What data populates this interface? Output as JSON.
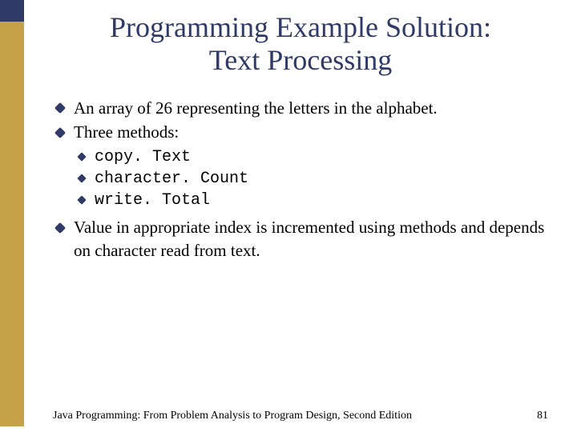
{
  "title_line1": "Programming Example Solution:",
  "title_line2": "Text Processing",
  "bullets": {
    "b0": "An array of 26 representing the letters in the alphabet.",
    "b1": "Three methods:",
    "b2": "Value in appropriate index is incremented using methods and depends on character read from text."
  },
  "methods": {
    "m0": "copy. Text",
    "m1": "character. Count",
    "m2": "write. Total"
  },
  "footer": {
    "book": "Java Programming: From Problem Analysis to Program Design, Second Edition",
    "page": "81"
  },
  "colors": {
    "accent": "#2f3a66",
    "stripe": "#c5a24a"
  }
}
